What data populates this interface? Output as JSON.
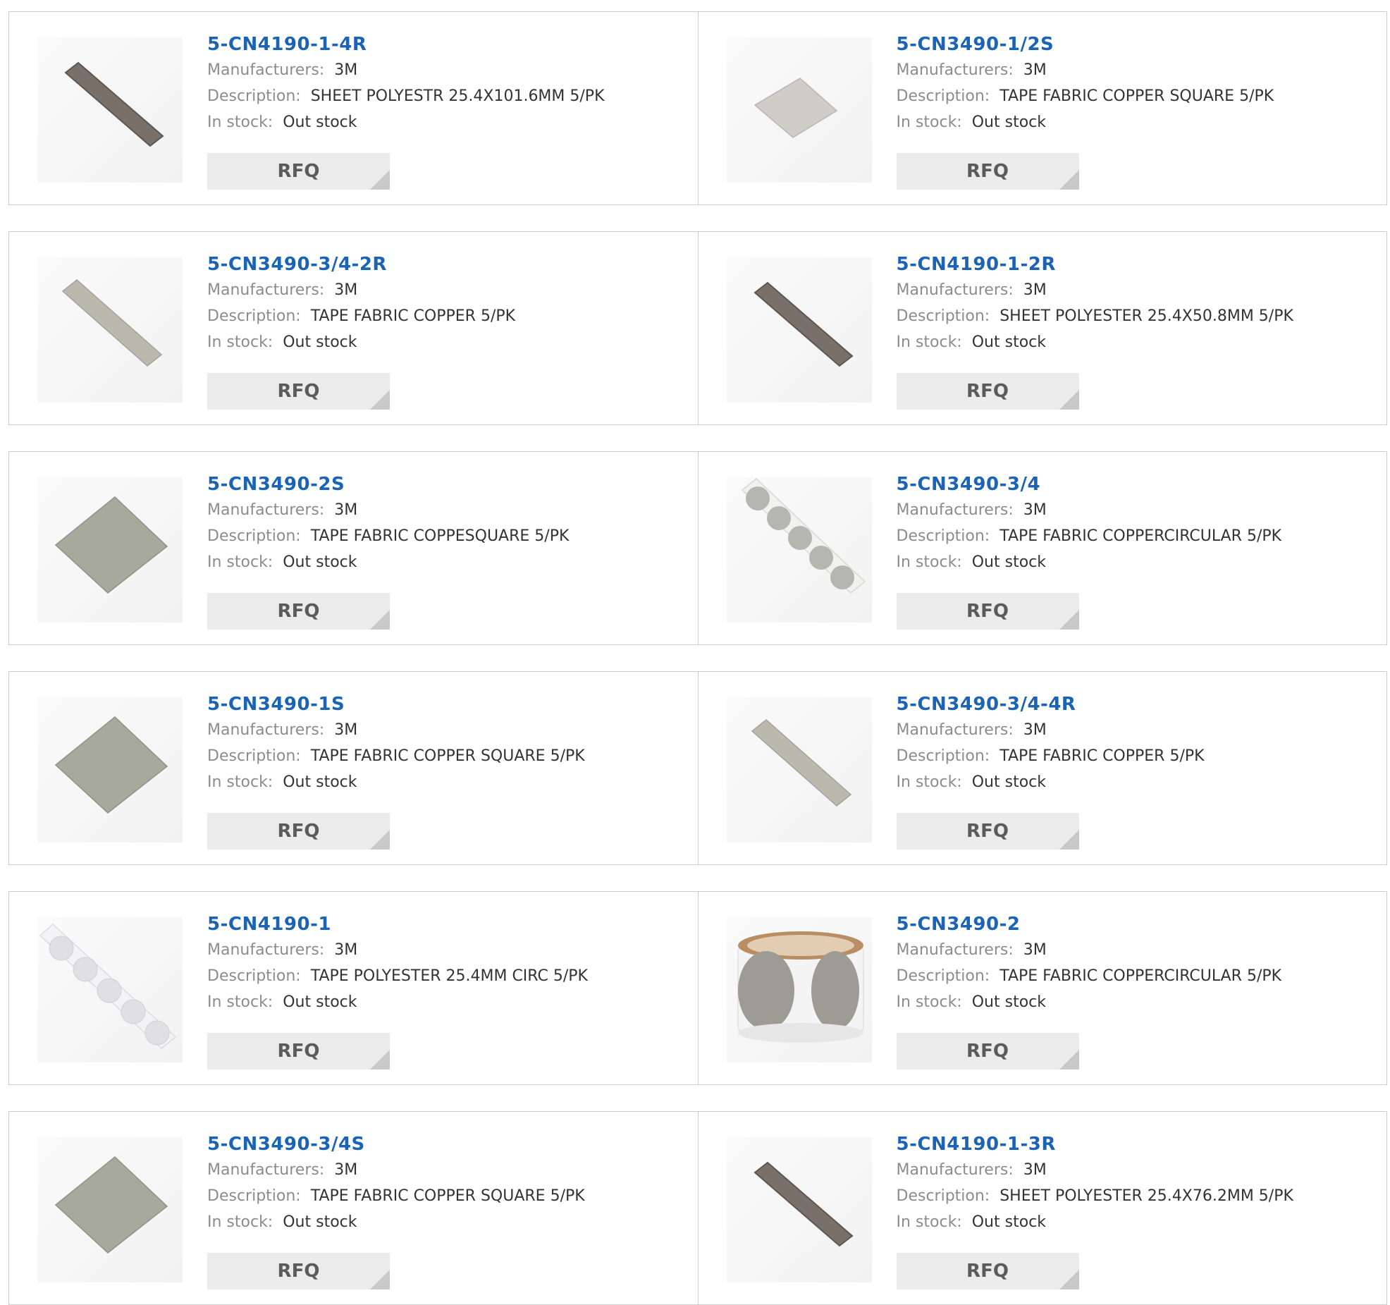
{
  "labels": {
    "manufacturers": "Manufacturers:",
    "description": "Description:",
    "in_stock": "In stock:",
    "rfq": "RFQ"
  },
  "colors": {
    "part_link": "#1b63b4",
    "label": "#8c8c8c",
    "value": "#333333",
    "rfq_bg": "#ebebeb",
    "border": "#cdcdcd"
  },
  "products": [
    {
      "part": "5-CN4190-1-4R",
      "manufacturer": "3M",
      "description": "SHEET POLYESTR 25.4X101.6MM 5/PK",
      "stock": "Out stock",
      "image": "dark-strip"
    },
    {
      "part": "5-CN3490-1/2S",
      "manufacturer": "3M",
      "description": "TAPE FABRIC COPPER SQUARE 5/PK",
      "stock": "Out stock",
      "image": "small-light-square"
    },
    {
      "part": "5-CN3490-3/4-2R",
      "manufacturer": "3M",
      "description": "TAPE FABRIC COPPER 5/PK",
      "stock": "Out stock",
      "image": "light-strip"
    },
    {
      "part": "5-CN4190-1-2R",
      "manufacturer": "3M",
      "description": "SHEET POLYESTER 25.4X50.8MM 5/PK",
      "stock": "Out stock",
      "image": "dark-strip"
    },
    {
      "part": "5-CN3490-2S",
      "manufacturer": "3M",
      "description": "TAPE FABRIC COPPESQUARE 5/PK",
      "stock": "Out stock",
      "image": "fabric-square"
    },
    {
      "part": "5-CN3490-3/4",
      "manufacturer": "3M",
      "description": "TAPE FABRIC COPPERCIRCULAR 5/PK",
      "stock": "Out stock",
      "image": "dots-strip"
    },
    {
      "part": "5-CN3490-1S",
      "manufacturer": "3M",
      "description": "TAPE FABRIC COPPER SQUARE 5/PK",
      "stock": "Out stock",
      "image": "fabric-square"
    },
    {
      "part": "5-CN3490-3/4-4R",
      "manufacturer": "3M",
      "description": "TAPE FABRIC COPPER 5/PK",
      "stock": "Out stock",
      "image": "light-strip"
    },
    {
      "part": "5-CN4190-1",
      "manufacturer": "3M",
      "description": "TAPE POLYESTER 25.4MM CIRC 5/PK",
      "stock": "Out stock",
      "image": "clear-dots-strip"
    },
    {
      "part": "5-CN3490-2",
      "manufacturer": "3M",
      "description": "TAPE FABRIC COPPERCIRCULAR 5/PK",
      "stock": "Out stock",
      "image": "roll"
    },
    {
      "part": "5-CN3490-3/4S",
      "manufacturer": "3M",
      "description": "TAPE FABRIC COPPER SQUARE 5/PK",
      "stock": "Out stock",
      "image": "fabric-square"
    },
    {
      "part": "5-CN4190-1-3R",
      "manufacturer": "3M",
      "description": "SHEET POLYESTER 25.4X76.2MM 5/PK",
      "stock": "Out stock",
      "image": "dark-strip"
    }
  ]
}
